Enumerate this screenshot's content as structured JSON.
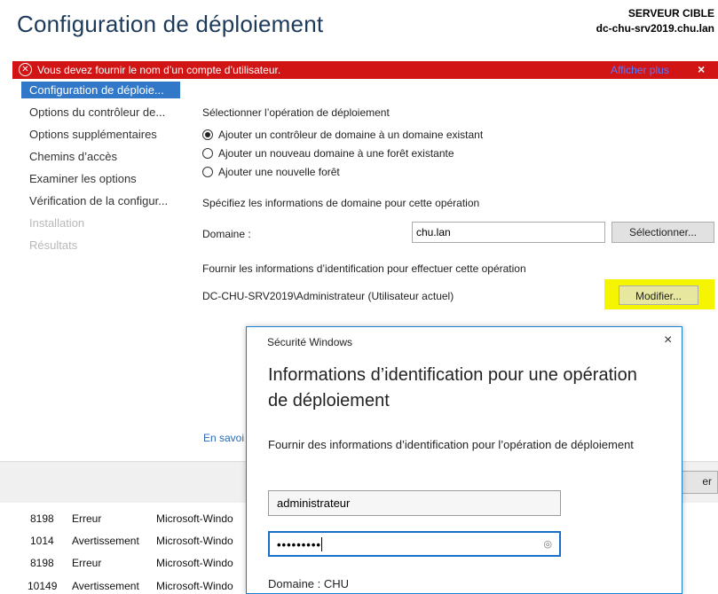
{
  "header": {
    "title": "Configuration de déploiement",
    "server_label": "SERVEUR CIBLE",
    "server_name": "dc-chu-srv2019.chu.lan"
  },
  "error_bar": {
    "message": "Vous devez fournir le nom d’un compte d’utilisateur.",
    "more_link": "Afficher plus",
    "close": "×",
    "color": "#d11414"
  },
  "sidebar": {
    "items": [
      {
        "label": "Configuration de déploie..."
      },
      {
        "label": "Options du contrôleur de..."
      },
      {
        "label": "Options supplémentaires"
      },
      {
        "label": "Chemins d’accès"
      },
      {
        "label": "Examiner les options"
      },
      {
        "label": "Vérification de la configur..."
      },
      {
        "label": "Installation"
      },
      {
        "label": "Résultats"
      }
    ],
    "accent": "#3278c8"
  },
  "main": {
    "select_operation_label": "Sélectionner l’opération de déploiement",
    "options": [
      {
        "label": "Ajouter un contrôleur de domaine à un domaine existant",
        "selected": true
      },
      {
        "label": "Ajouter un nouveau domaine à une forêt existante",
        "selected": false
      },
      {
        "label": "Ajouter une nouvelle forêt",
        "selected": false
      }
    ],
    "domain_info_label": "Spécifiez les informations de domaine pour cette opération",
    "domain_label": "Domaine :",
    "domain_value": "chu.lan",
    "select_button": "Sélectionner...",
    "credentials_label": "Fournir les informations d’identification pour effectuer cette opération",
    "current_user": "DC-CHU-SRV2019\\Administrateur (Utilisateur actuel)",
    "modify_button": "Modifier...",
    "learn_more": "En savoi",
    "highlight_color": "#f5f500"
  },
  "bottom": {
    "button_fragment": "er"
  },
  "event_log": [
    {
      "id": "8198",
      "level": "Erreur",
      "source": "Microsoft-Windo"
    },
    {
      "id": "1014",
      "level": "Avertissement",
      "source": "Microsoft-Windo"
    },
    {
      "id": "8198",
      "level": "Erreur",
      "source": "Microsoft-Windo"
    },
    {
      "id": "10149",
      "level": "Avertissement",
      "source": "Microsoft-Windo"
    }
  ],
  "dialog": {
    "title": "Sécurité Windows",
    "close": "×",
    "heading": "Informations d’identification pour une opération de déploiement",
    "description": "Fournir des informations d’identification pour l’opération de déploiement",
    "username_value": "administrateur",
    "password_mask": "•••••••••",
    "domain_line": "Domaine : CHU",
    "border_color": "#1880d0"
  }
}
